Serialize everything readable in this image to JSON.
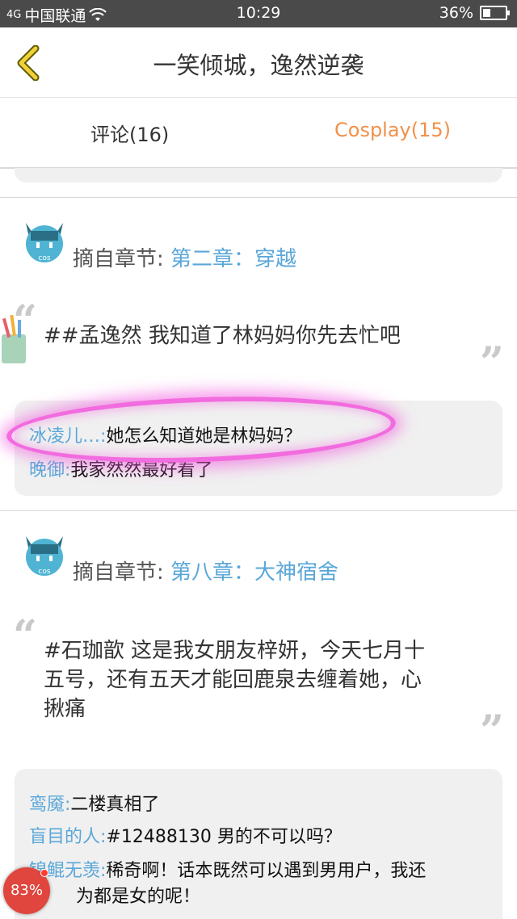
{
  "status_bar": {
    "signal": "4G",
    "carrier": "中国联通",
    "time": "10:29",
    "battery": "36%"
  },
  "header": {
    "title": "一笑倾城，逸然逆袭"
  },
  "tabs": [
    {
      "label": "评论(16)"
    },
    {
      "label": "Cosplay(15)"
    }
  ],
  "posts": [
    {
      "chapter_prefix": "摘自章节:",
      "chapter_link": "第二章：穿越",
      "quote": "##孟逸然 我知道了林妈妈你先去忙吧",
      "comments": [
        {
          "user": "冰凌儿…:",
          "text": "她怎么知道她是林妈妈？"
        },
        {
          "user": "晚御:",
          "text": "我家然然最好看了"
        }
      ]
    },
    {
      "chapter_prefix": "摘自章节:",
      "chapter_link": "第八章：大神宿舍",
      "quote_lines": [
        "#石珈歆 这是我女朋友梓妍，今天七月十",
        "五号，还有五天才能回鹿泉去缠着她，心",
        "揪痛"
      ],
      "comments": [
        {
          "user": "鸾魇:",
          "text": "二楼真相了"
        },
        {
          "user": "盲目的人:",
          "text": "#12488130 男的不可以吗？"
        },
        {
          "user": "锦鲲无羡:",
          "text": "稀奇啊！话本既然可以遇到男用户，我还"
        },
        {
          "user": "",
          "text": "为都是女的呢！"
        }
      ]
    }
  ],
  "avatar_label": "cos",
  "quote_marks": {
    "open": "“",
    "close": "”"
  },
  "floating_badge": "83%",
  "colors": {
    "link": "#5aa7d9",
    "active_tab": "#f0914a",
    "highlight": "#f26bdf",
    "badge": "#e0463e"
  }
}
